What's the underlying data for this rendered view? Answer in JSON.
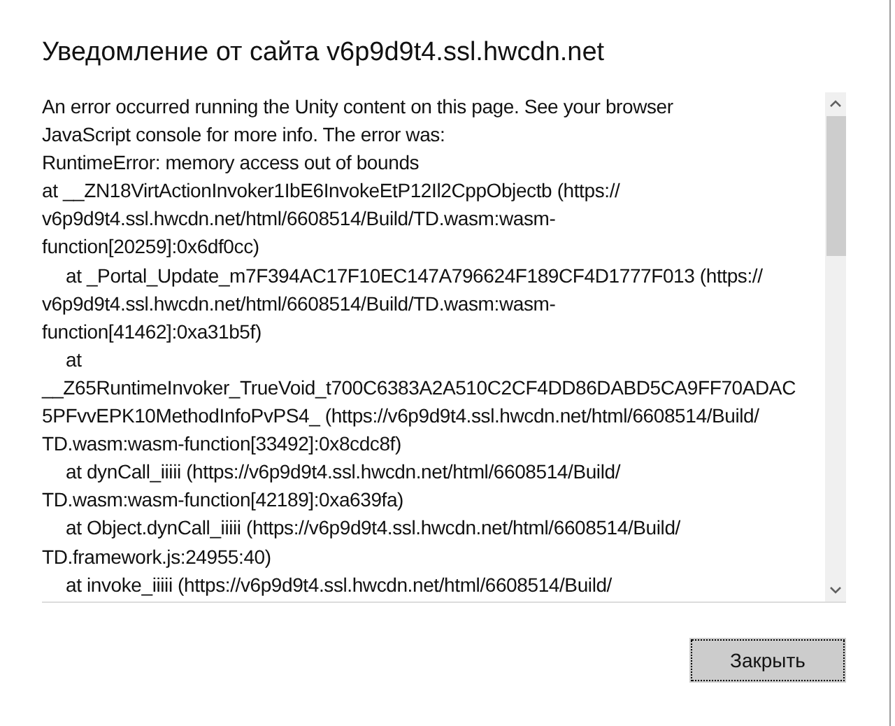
{
  "dialog": {
    "title": "Уведомление от сайта v6p9d9t4.ssl.hwcdn.net",
    "message_lines": [
      {
        "text": "An error occurred running the Unity content on this page. See your browser",
        "indented": false
      },
      {
        "text": "JavaScript console for more info. The error was:",
        "indented": false
      },
      {
        "text": "RuntimeError: memory access out of bounds",
        "indented": false
      },
      {
        "text": "at __ZN18VirtActionInvoker1IbE6InvokeEtP12Il2CppObjectb (https://",
        "indented": false
      },
      {
        "text": "v6p9d9t4.ssl.hwcdn.net/html/6608514/Build/TD.wasm:wasm-",
        "indented": false
      },
      {
        "text": "function[20259]:0x6df0cc)",
        "indented": false
      },
      {
        "text": "at _Portal_Update_m7F394AC17F10EC147A796624F189CF4D1777F013 (https://",
        "indented": true
      },
      {
        "text": "v6p9d9t4.ssl.hwcdn.net/html/6608514/Build/TD.wasm:wasm-",
        "indented": false
      },
      {
        "text": "function[41462]:0xa31b5f)",
        "indented": false
      },
      {
        "text": "at",
        "indented": true
      },
      {
        "text": "__Z65RuntimeInvoker_TrueVoid_t700C6383A2A510C2CF4DD86DABD5CA9FF70ADAC",
        "indented": false
      },
      {
        "text": "5PFvvEPK10MethodInfoPvPS4_ (https://v6p9d9t4.ssl.hwcdn.net/html/6608514/Build/",
        "indented": false
      },
      {
        "text": "TD.wasm:wasm-function[33492]:0x8cdc8f)",
        "indented": false
      },
      {
        "text": "at dynCall_iiiii (https://v6p9d9t4.ssl.hwcdn.net/html/6608514/Build/",
        "indented": true
      },
      {
        "text": "TD.wasm:wasm-function[42189]:0xa639fa)",
        "indented": false
      },
      {
        "text": "at Object.dynCall_iiiii (https://v6p9d9t4.ssl.hwcdn.net/html/6608514/Build/",
        "indented": true
      },
      {
        "text": "TD.framework.js:24955:40)",
        "indented": false
      },
      {
        "text": "at invoke_iiiii (https://v6p9d9t4.ssl.hwcdn.net/html/6608514/Build/",
        "indented": true
      }
    ],
    "close_button": {
      "label": "Закрыть",
      "focused": true
    }
  }
}
